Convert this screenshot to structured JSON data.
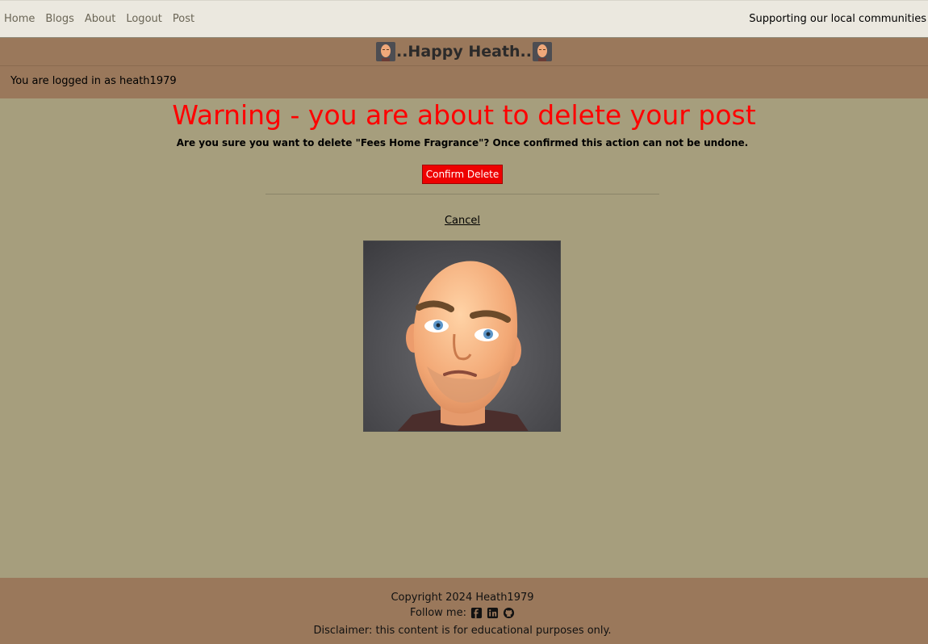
{
  "nav": {
    "links": [
      "Home",
      "Blogs",
      "About",
      "Logout",
      "Post"
    ],
    "tagline": "Supporting our local communities"
  },
  "brand": {
    "title": "..Happy Heath.."
  },
  "user": {
    "logged_in_text": "You are logged in as heath1979"
  },
  "main": {
    "warning_heading": "Warning - you are about to delete your post",
    "confirm_text": "Are you sure you want to delete \"Fees Home Fragrance\"? Once confirmed this action can not be undone.",
    "confirm_button": "Confirm Delete",
    "cancel_link": "Cancel"
  },
  "footer": {
    "copyright": "Copyright 2024 Heath1979",
    "follow_label": "Follow me:",
    "social_icons": [
      "facebook-icon",
      "linkedin-icon",
      "github-icon"
    ],
    "disclaimer": "Disclaimer: this content is for educational purposes only."
  },
  "colors": {
    "page_background": "#a69e7d",
    "header_brown": "#9a785b",
    "nav_background": "#ebe8df",
    "warning_red": "#ff0000",
    "button_red": "#ee0000"
  }
}
